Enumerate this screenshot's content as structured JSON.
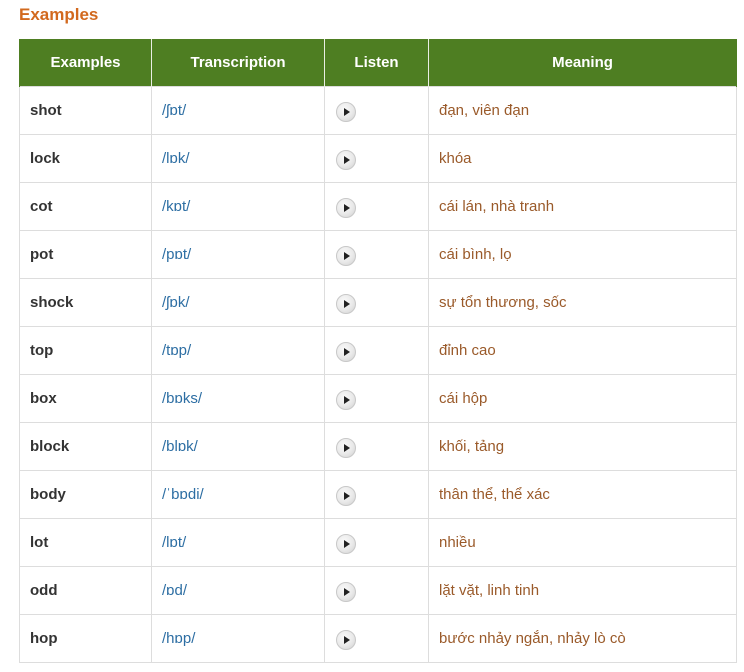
{
  "section": {
    "title": "Examples"
  },
  "table": {
    "headers": [
      "Examples",
      "Transcription",
      "Listen",
      "Meaning"
    ],
    "rows": [
      {
        "word": "shot",
        "ipa": "/ʃɒt/",
        "meaning": "đạn, viên đạn"
      },
      {
        "word": "lock",
        "ipa": "/lɒk/",
        "meaning": "khóa"
      },
      {
        "word": "cot",
        "ipa": "/kɒt/",
        "meaning": "cái lán, nhà tranh"
      },
      {
        "word": "pot",
        "ipa": "/pɒt/",
        "meaning": "cái bình, lọ"
      },
      {
        "word": "shock",
        "ipa": "/ʃɒk/",
        "meaning": "sự tổn thương, sốc"
      },
      {
        "word": "top",
        "ipa": "/tɒp/",
        "meaning": "đỉnh cao"
      },
      {
        "word": "box",
        "ipa": "/bɒks/",
        "meaning": "cái hộp"
      },
      {
        "word": "block",
        "ipa": "/blɒk/",
        "meaning": "khối, tảng"
      },
      {
        "word": "body",
        "ipa": "/ˈbɒdi/",
        "meaning": "thân thể, thể xác"
      },
      {
        "word": "lot",
        "ipa": "/lɒt/",
        "meaning": "nhiều"
      },
      {
        "word": "odd",
        "ipa": "/ɒd/",
        "meaning": "lặt vặt, linh tinh"
      },
      {
        "word": "hop",
        "ipa": "/hɒp/",
        "meaning": "bước nhảy ngắn, nhảy lò cò"
      }
    ]
  },
  "icons": {
    "play": "play-icon"
  },
  "colors": {
    "title": "#d2691e",
    "header_bg": "#4e7e22",
    "header_text": "#ffffff",
    "transcription": "#2d6ea3",
    "meaning": "#9a5a2a",
    "border": "#dddddd"
  }
}
